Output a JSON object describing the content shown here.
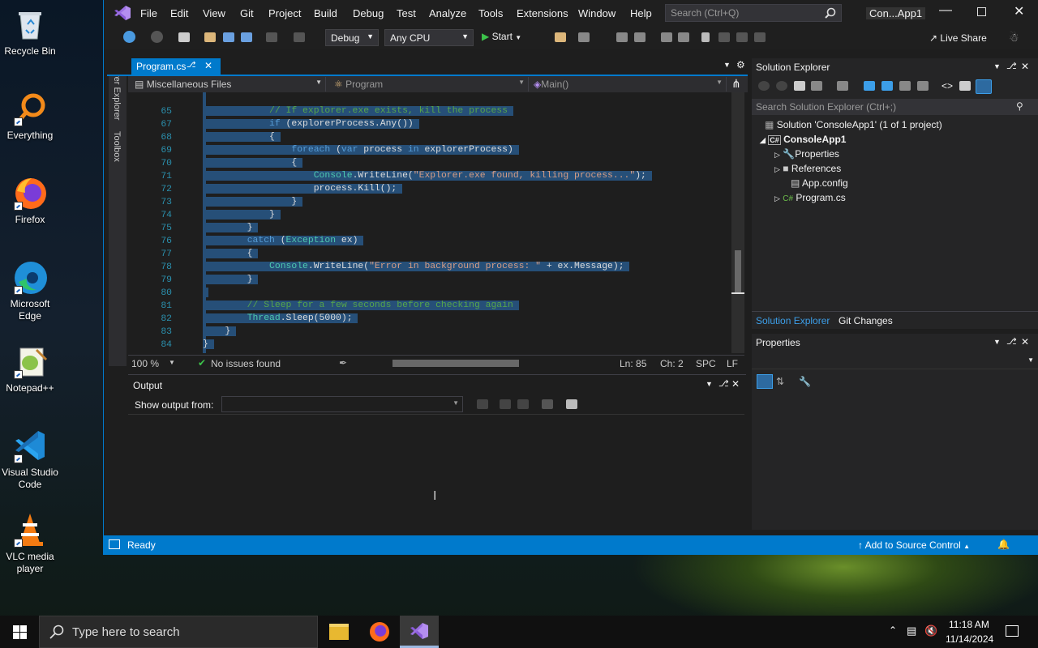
{
  "desktop": {
    "icons": [
      {
        "label": "Recycle Bin"
      },
      {
        "label": "Everything"
      },
      {
        "label": "Firefox"
      },
      {
        "label": "Microsoft Edge"
      },
      {
        "label": "Notepad++"
      },
      {
        "label": "Visual Studio Code"
      },
      {
        "label": "VLC media player"
      }
    ]
  },
  "vs": {
    "menu": [
      "File",
      "Edit",
      "View",
      "Git",
      "Project",
      "Build",
      "Debug",
      "Test",
      "Analyze",
      "Tools",
      "Extensions",
      "Window",
      "Help"
    ],
    "search_placeholder": "Search (Ctrl+Q)",
    "solution_title": "Con...App1",
    "toolbar": {
      "config": "Debug",
      "platform": "Any CPU",
      "start": "Start",
      "live_share": "Live Share"
    },
    "side_tabs": [
      "Server Explorer",
      "Toolbox"
    ],
    "doc_tab": "Program.cs",
    "nav": {
      "project": "Miscellaneous Files",
      "class": "Program",
      "member": "Main()"
    },
    "code": [
      {
        "n": "65",
        "t": "            // If explorer.exe exists, kill the process"
      },
      {
        "n": "67",
        "t": "            if (explorerProcess.Any())"
      },
      {
        "n": "68",
        "t": "            {"
      },
      {
        "n": "69",
        "t": "                foreach (var process in explorerProcess)"
      },
      {
        "n": "70",
        "t": "                {"
      },
      {
        "n": "71",
        "t": "                    Console.WriteLine(\"Explorer.exe found, killing process...\");"
      },
      {
        "n": "72",
        "t": "                    process.Kill();"
      },
      {
        "n": "73",
        "t": "                }"
      },
      {
        "n": "74",
        "t": "            }"
      },
      {
        "n": "75",
        "t": "        }"
      },
      {
        "n": "76",
        "t": "        catch (Exception ex)"
      },
      {
        "n": "77",
        "t": "        {"
      },
      {
        "n": "78",
        "t": "            Console.WriteLine(\"Error in background process: \" + ex.Message);"
      },
      {
        "n": "79",
        "t": "        }"
      },
      {
        "n": "80",
        "t": ""
      },
      {
        "n": "81",
        "t": "        // Sleep for a few seconds before checking again"
      },
      {
        "n": "82",
        "t": "        Thread.Sleep(5000);"
      },
      {
        "n": "83",
        "t": "    }"
      },
      {
        "n": "84",
        "t": "}"
      }
    ],
    "editor_status": {
      "zoom": "100 %",
      "issues": "No issues found",
      "ln": "Ln: 85",
      "ch": "Ch: 2",
      "spc": "SPC",
      "lf": "LF"
    },
    "output": {
      "title": "Output",
      "show_from": "Show output from:"
    },
    "solution_explorer": {
      "title": "Solution Explorer",
      "search": "Search Solution Explorer (Ctrl+;)",
      "solution": "Solution 'ConsoleApp1' (1 of 1 project)",
      "project": "ConsoleApp1",
      "items": [
        "Properties",
        "References",
        "App.config",
        "Program.cs"
      ],
      "tabs": [
        "Solution Explorer",
        "Git Changes"
      ]
    },
    "properties": {
      "title": "Properties"
    },
    "status": {
      "ready": "Ready",
      "source_control": "Add to Source Control"
    }
  },
  "taskbar": {
    "search": "Type here to search",
    "time": "11:18 AM",
    "date": "11/14/2024"
  },
  "colors": {
    "accent": "#007acc",
    "selection": "#264f78",
    "comment": "#57a64a",
    "keyword": "#569cd6",
    "type": "#4ec9b0",
    "string": "#d69d85"
  }
}
